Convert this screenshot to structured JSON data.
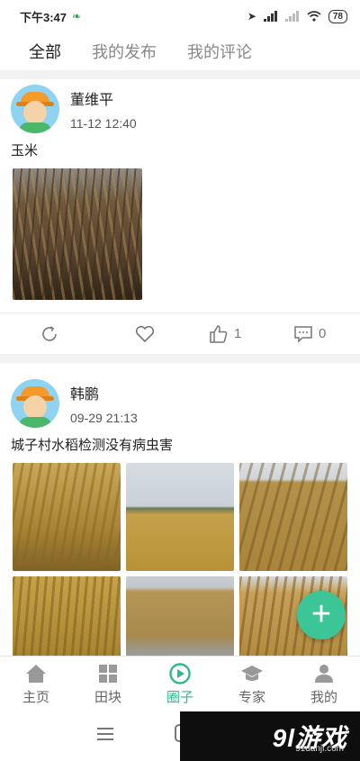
{
  "status_bar": {
    "time": "下午3:47",
    "battery": "78"
  },
  "tabs": [
    {
      "label": "全部",
      "active": true
    },
    {
      "label": "我的发布",
      "active": false
    },
    {
      "label": "我的评论",
      "active": false
    }
  ],
  "posts": [
    {
      "author": "董维平",
      "date": "11-12 12:40",
      "text": "玉米",
      "likes": "1",
      "comments": "0"
    },
    {
      "author": "韩鹏",
      "date": "09-29 21:13",
      "text": "城子村水稻检测没有病虫害"
    }
  ],
  "bottom_nav": [
    {
      "label": "主页",
      "icon": "home-icon"
    },
    {
      "label": "田块",
      "icon": "field-icon"
    },
    {
      "label": "圈子",
      "icon": "circle-icon",
      "active": true
    },
    {
      "label": "专家",
      "icon": "expert-icon"
    },
    {
      "label": "我的",
      "icon": "profile-icon"
    }
  ],
  "colors": {
    "accent": "#2fb88b",
    "fab": "#3cc597"
  },
  "watermark": {
    "logo": "9l游戏",
    "url": "91danji.com"
  }
}
